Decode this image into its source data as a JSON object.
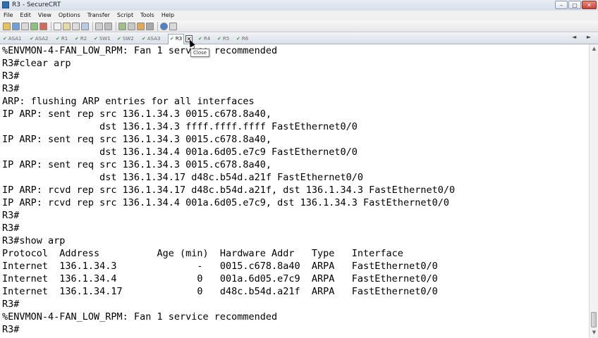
{
  "window": {
    "title": "R3 - SecureCRT",
    "buttons": {
      "minimize": "–",
      "maximize": "□",
      "close": "✕"
    }
  },
  "menu": [
    "File",
    "Edit",
    "View",
    "Options",
    "Transfer",
    "Script",
    "Tools",
    "Help"
  ],
  "toolbar": {
    "icons": [
      "connect-icon",
      "quick-connect-icon",
      "connect-tab-icon",
      "reconnect-icon",
      "disconnect-icon",
      "copy-icon",
      "paste-icon",
      "copy-paste-icon",
      "find-icon",
      "print-icon",
      "print-setup-icon",
      "session-options-icon",
      "global-options-icon",
      "sftp-icon",
      "keymap-icon",
      "help-icon",
      "about-icon"
    ]
  },
  "tabs": [
    {
      "label": "ASA1",
      "active": false
    },
    {
      "label": "ASA2",
      "active": false
    },
    {
      "label": "R1",
      "active": false
    },
    {
      "label": "R2",
      "active": false
    },
    {
      "label": "SW1",
      "active": false
    },
    {
      "label": "SW2",
      "active": false
    },
    {
      "label": "ASA3",
      "active": false
    },
    {
      "label": "R3",
      "active": true
    },
    {
      "label": "R4",
      "active": false
    },
    {
      "label": "R5",
      "active": false
    },
    {
      "label": "R6",
      "active": false
    }
  ],
  "tab_close_label": "✕",
  "tooltip": "Close",
  "tab_scroll": "◄ ►",
  "terminal": {
    "lines": [
      "%ENVMON-4-FAN_LOW_RPM: Fan 1 service recommended",
      "R3#clear arp",
      "R3#",
      "R3#",
      "ARP: flushing ARP entries for all interfaces",
      "IP ARP: sent rep src 136.1.34.3 0015.c678.8a40,",
      "                 dst 136.1.34.3 ffff.ffff.ffff FastEthernet0/0",
      "IP ARP: sent req src 136.1.34.3 0015.c678.8a40,",
      "                 dst 136.1.34.4 001a.6d05.e7c9 FastEthernet0/0",
      "IP ARP: sent req src 136.1.34.3 0015.c678.8a40,",
      "                 dst 136.1.34.17 d48c.b54d.a21f FastEthernet0/0",
      "IP ARP: rcvd rep src 136.1.34.17 d48c.b54d.a21f, dst 136.1.34.3 FastEthernet0/0",
      "IP ARP: rcvd rep src 136.1.34.4 001a.6d05.e7c9, dst 136.1.34.3 FastEthernet0/0",
      "R3#",
      "R3#",
      "R3#show arp",
      "Protocol  Address          Age (min)  Hardware Addr   Type   Interface",
      "Internet  136.1.34.3              -   0015.c678.8a40  ARPA   FastEthernet0/0",
      "Internet  136.1.34.4              0   001a.6d05.e7c9  ARPA   FastEthernet0/0",
      "Internet  136.1.34.17             0   d48c.b54d.a21f  ARPA   FastEthernet0/0",
      "R3#",
      "%ENVMON-4-FAN_LOW_RPM: Fan 1 service recommended",
      "R3#"
    ]
  },
  "scrollbar": {
    "up": "▲",
    "down": "▼"
  },
  "colors": {
    "tab_check": "#3e9a3e",
    "title_close": "#c9453a"
  }
}
